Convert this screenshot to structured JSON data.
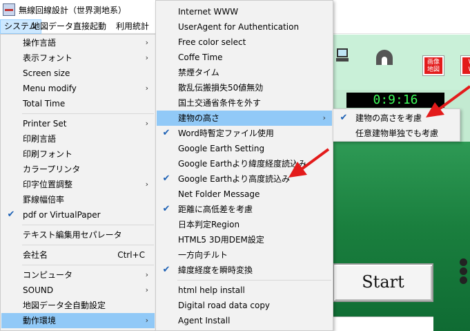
{
  "window": {
    "title": "無線回線設計（世界測地系）",
    "icon": "app-logo-icon"
  },
  "menubar": [
    {
      "label": "システム",
      "active": true
    },
    {
      "label": "地図データ"
    },
    {
      "label": "直接起動"
    },
    {
      "label": "利用統計"
    }
  ],
  "main_menu": [
    {
      "label": "操作言語",
      "submenu": true
    },
    {
      "label": "表示フォント",
      "submenu": true
    },
    {
      "label": "Screen size"
    },
    {
      "label": "Menu modify",
      "submenu": true
    },
    {
      "label": "Total Time"
    },
    {
      "separator": true
    },
    {
      "label": "Printer Set",
      "submenu": true
    },
    {
      "label": "印刷言語"
    },
    {
      "label": "印刷フォント"
    },
    {
      "label": "カラープリンタ"
    },
    {
      "label": "印字位置調整",
      "submenu": true
    },
    {
      "label": "罫線幅倍率"
    },
    {
      "label": "pdf or VirtualPaper",
      "checked": true
    },
    {
      "separator": true
    },
    {
      "label": "テキスト編集用セパレータ"
    },
    {
      "separator": true
    },
    {
      "label": "会社名",
      "shortcut": "Ctrl+C"
    },
    {
      "separator": true
    },
    {
      "label": "コンピュータ",
      "submenu": true
    },
    {
      "label": "SOUND",
      "submenu": true
    },
    {
      "label": "地図データ全自動設定"
    },
    {
      "label": "動作環境",
      "submenu": true,
      "highlighted": true
    }
  ],
  "env_menu": [
    {
      "label": "Internet WWW"
    },
    {
      "label": "UserAgent for Authentication"
    },
    {
      "label": "Free color select"
    },
    {
      "label": "Coffe Time"
    },
    {
      "label": "禁煙タイム"
    },
    {
      "label": "散乱伝搬損失50値無効"
    },
    {
      "label": "国土交通省条件を外す"
    },
    {
      "label": "建物の高さ",
      "submenu": true,
      "highlighted": true
    },
    {
      "label": "Word時暫定ファイル使用",
      "checked": true
    },
    {
      "label": "Google Earth Setting"
    },
    {
      "label": "Google Earthより緯度経度読込み"
    },
    {
      "label": "Google Earthより高度読込み",
      "checked": true
    },
    {
      "label": "Net Folder Message"
    },
    {
      "label": "距離に高低差を考慮",
      "checked": true
    },
    {
      "label": "日本判定Region"
    },
    {
      "label": "HTML5 3D用DEM設定"
    },
    {
      "label": "一方向チルト"
    },
    {
      "label": "緯度経度を瞬時変換",
      "checked": true
    },
    {
      "separator": true
    },
    {
      "label": "html help install"
    },
    {
      "label": "Digital road data copy"
    },
    {
      "label": "Agent Install"
    }
  ],
  "building_menu": [
    {
      "label": "建物の高さを考慮",
      "checked": true
    },
    {
      "label": "任意建物単独でも考慮"
    }
  ],
  "background": {
    "timer": "0:9:16",
    "start_label": "Start",
    "red_button_1": "画像\n地図",
    "red_button_2": "W\nW",
    "field_color": "#1a7f3e",
    "highlight_color": "#91c9f7",
    "arrow_color": "#e31b1b"
  }
}
